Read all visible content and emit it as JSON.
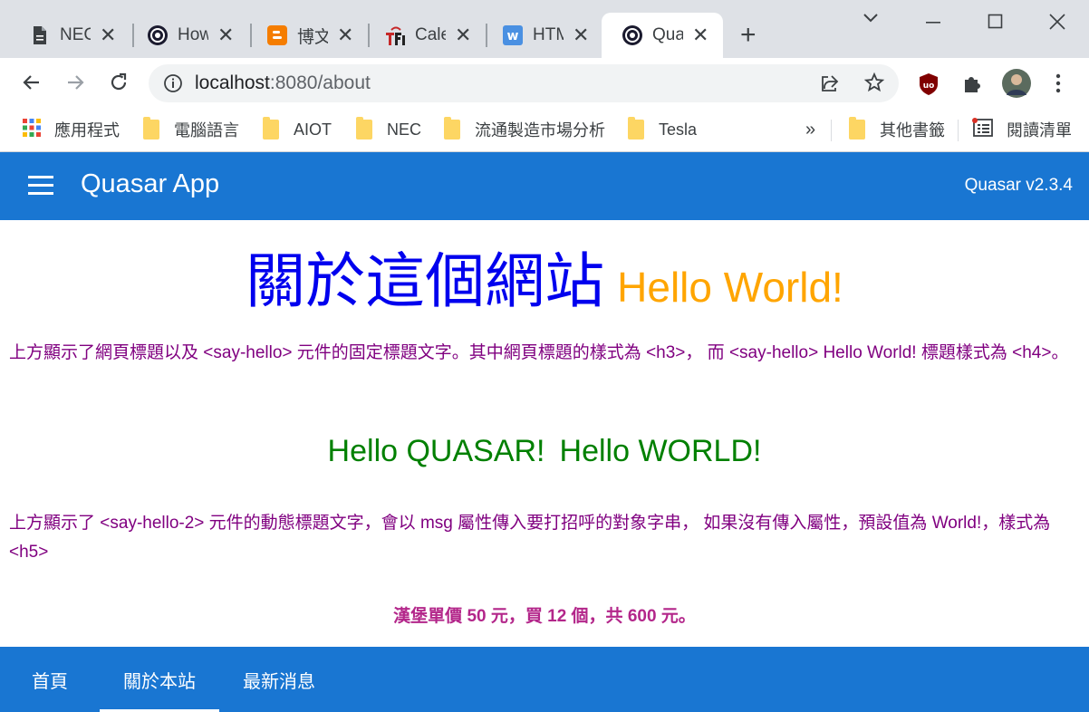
{
  "browser": {
    "tabs": [
      {
        "title": "NEC",
        "icon": "document-icon"
      },
      {
        "title": "How",
        "icon": "quasar-logo-icon"
      },
      {
        "title": "博文",
        "icon": "blogger-icon"
      },
      {
        "title": "Cale",
        "icon": "tfi-icon"
      },
      {
        "title": "HTM",
        "icon": "w-icon"
      },
      {
        "title": "Qua",
        "icon": "quasar-logo-icon",
        "active": true
      }
    ],
    "url_host": "localhost",
    "url_rest": ":8080/about",
    "bookmarks": {
      "apps": "應用程式",
      "items": [
        "電腦語言",
        "AIOT",
        "NEC",
        "流通製造市場分析",
        "Tesla"
      ],
      "more": "»",
      "other": "其他書籤",
      "reading_list": "閱讀清單"
    }
  },
  "app": {
    "title": "Quasar App",
    "version": "Quasar v2.3.4",
    "heading": "關於這個網站",
    "heading_hello": "Hello World!",
    "para1": "上方顯示了網頁標題以及 <say-hello> 元件的固定標題文字。其中網頁標題的樣式為 <h3>， 而 <say-hello> Hello World! 標題樣式為 <h4>。",
    "hello_quasar": "Hello QUASAR!",
    "hello_world": "Hello WORLD!",
    "para2": "上方顯示了 <say-hello-2> 元件的動態標題文字，會以 msg 屬性傳入要打招呼的對象字串， 如果沒有傳入屬性，預設值為 World!，樣式為 <h5>",
    "price_line": "漢堡單價 50 元，買 12 個，共 600 元。",
    "footer_tabs": [
      "首頁",
      "關於本站",
      "最新消息"
    ]
  },
  "colors": {
    "primary": "#1976d2",
    "heading": "#0000ee",
    "hello": "#ffa500",
    "paragraph": "#800080",
    "hello2": "#008000",
    "price": "#b3268a"
  }
}
